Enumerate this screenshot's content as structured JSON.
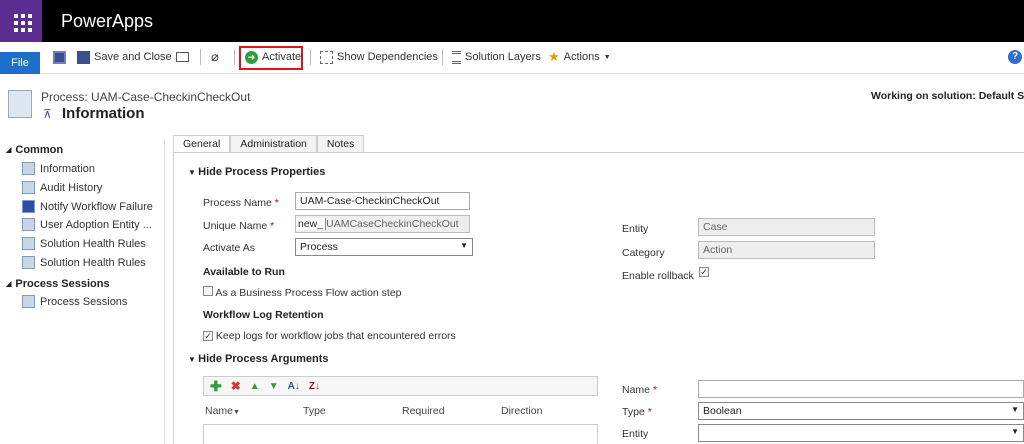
{
  "app": {
    "title": "PowerApps"
  },
  "toolbar": {
    "file": "File",
    "save_close": "Save and Close",
    "activate": "Activate",
    "show_dependencies": "Show Dependencies",
    "solution_layers": "Solution Layers",
    "actions": "Actions"
  },
  "header": {
    "process": "Process: UAM-Case-CheckinCheckOut",
    "form": "Information",
    "solution": "Working on solution: Default Solu"
  },
  "nav": {
    "common": "Common",
    "common_items": [
      "Information",
      "Audit History",
      "Notify Workflow Failure",
      "User Adoption Entity ...",
      "Solution Health Rules",
      "Solution Health Rules"
    ],
    "sessions": "Process Sessions",
    "session_items": [
      "Process Sessions"
    ]
  },
  "tabs": [
    "General",
    "Administration",
    "Notes"
  ],
  "props": {
    "section": "Hide Process Properties",
    "process_name_label": "Process Name",
    "process_name": "UAM-Case-CheckinCheckOut",
    "unique_name_label": "Unique Name",
    "unique_prefix": "new_",
    "unique_name": "UAMCaseCheckinCheckOut",
    "activate_as_label": "Activate As",
    "activate_as": "Process",
    "available": "Available to Run",
    "bpf_step": "As a Business Process Flow action step",
    "log_retention": "Workflow Log Retention",
    "keep_logs": "Keep logs for workflow jobs that encountered errors",
    "entity_label": "Entity",
    "entity": "Case",
    "category_label": "Category",
    "category": "Action",
    "rollback_label": "Enable rollback"
  },
  "args": {
    "section": "Hide Process Arguments",
    "columns": [
      "Name",
      "Type",
      "Required",
      "Direction"
    ],
    "name_label": "Name",
    "type_label": "Type",
    "type": "Boolean",
    "entity_label": "Entity"
  }
}
